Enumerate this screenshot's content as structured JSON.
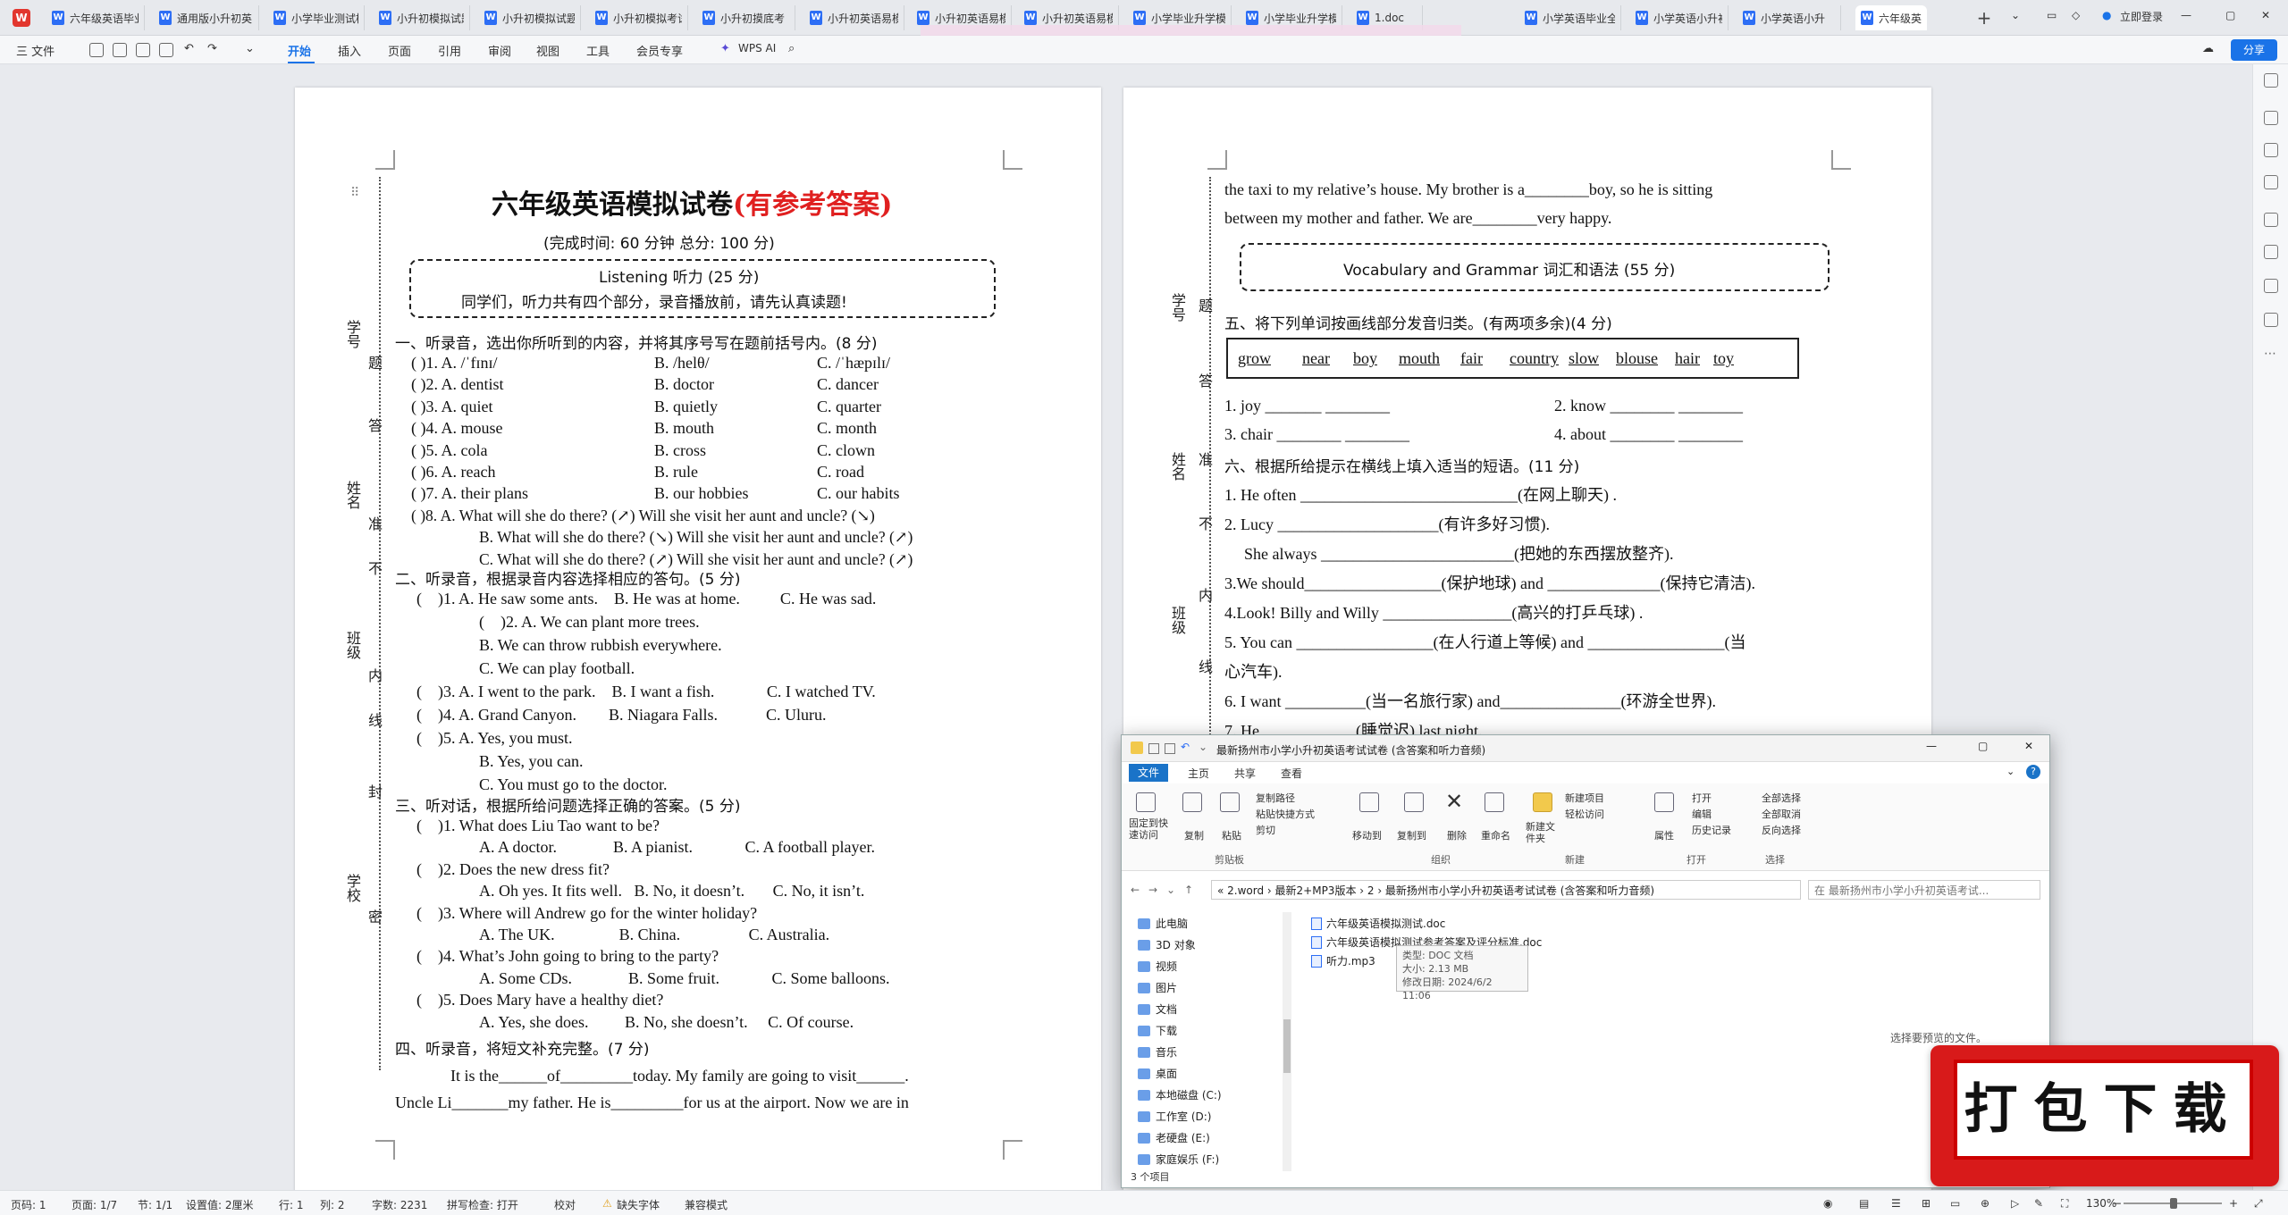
{
  "tabs": [
    {
      "label": "六年级英语毕业"
    },
    {
      "label": "通用版小升初英"
    },
    {
      "label": "小学毕业测试模"
    },
    {
      "label": "小升初模拟试题"
    },
    {
      "label": "小升初模拟试题"
    },
    {
      "label": "小升初模拟考试"
    },
    {
      "label": "小升初摸底考"
    },
    {
      "label": "小升初英语易模"
    },
    {
      "label": "小升初英语易模"
    },
    {
      "label": "小升初英语易模"
    },
    {
      "label": "小学毕业升学模"
    },
    {
      "label": "小学毕业升学模"
    },
    {
      "label": "1.doc"
    },
    {
      "label": "小学英语毕业全"
    },
    {
      "label": "小学英语小升初"
    },
    {
      "label": "小学英语小升"
    },
    {
      "label": "六年级英"
    }
  ],
  "tabbar_right": {
    "login": "立即登录"
  },
  "toolbar": {
    "file": "三 文件",
    "menus": [
      "开始",
      "插入",
      "页面",
      "引用",
      "审阅",
      "视图",
      "工具",
      "会员专享"
    ],
    "wps_ai": "WPS AI",
    "share": "分享"
  },
  "page1": {
    "title_main": "六年级英语模拟试卷",
    "title_red": "(有参考答案)",
    "subtitle": "(完成时间: 60 分钟  总分: 100 分)",
    "box_line1": "Listening 听力 (25 分)",
    "box_line2": "同学们，听力共有四个部分，录音播放前，请先认真读题!",
    "side_labels": [
      "学号",
      "题",
      "答",
      "姓名",
      "准",
      "不",
      "班级",
      "内",
      "线",
      "封",
      "学校",
      "密"
    ],
    "sec1": "一、听录音，选出你所听到的内容，并将其序号写在题前括号内。(8 分)",
    "q1": [
      [
        "(    )1. A. /ˈfɪnɪ/",
        "B. /helθ/",
        "C. /ˈhæpɪlɪ/"
      ],
      [
        "(    )2. A. dentist",
        "B. doctor",
        "C. dancer"
      ],
      [
        "(    )3. A. quiet",
        "B. quietly",
        "C. quarter"
      ],
      [
        "(    )4. A. mouse",
        "B. mouth",
        "C. month"
      ],
      [
        "(    )5. A. cola",
        "B. cross",
        "C. clown"
      ],
      [
        "(    )6. A. reach",
        "B. rule",
        "C. road"
      ],
      [
        "(    )7. A. their plans",
        "B. our hobbies",
        "C. our habits"
      ]
    ],
    "q1_8": [
      "(    )8. A. What will she do there? (↗) Will she visit her aunt and uncle? (↘)",
      "B. What will she do there? (↘) Will she visit her aunt and uncle? (↗)",
      "C. What will she do there? (↗) Will she visit her aunt and uncle? (↗)"
    ],
    "sec2": "二、听录音，根据录音内容选择相应的答句。(5 分)",
    "q2": [
      "(    )1. A. He saw some ants.    B. He was at home.          C. He was sad.",
      "(    )2. A. We can plant more trees.",
      "B. We can throw rubbish everywhere.",
      "C. We can play football.",
      "(    )3. A. I went to the park.    B. I want a fish.             C. I watched TV.",
      "(    )4. A. Grand Canyon.        B. Niagara Falls.            C. Uluru.",
      "(    )5. A. Yes, you must.",
      "B. Yes, you can.",
      "C. You must go to the doctor."
    ],
    "sec3": "三、听对话，根据所给问题选择正确的答案。(5 分)",
    "q3": [
      "(    )1. What does Liu Tao want to be?",
      "A. A doctor.              B. A pianist.             C. A football player.",
      "(    )2. Does the new dress fit?",
      "A. Oh yes. It fits well.   B. No, it doesn’t.       C. No, it isn’t.",
      "(    )3. Where will Andrew go for the winter holiday?",
      "A. The UK.                B. China.                 C. Australia.",
      "(    )4. What’s John going to bring to the party?",
      "A. Some CDs.              B. Some fruit.             C. Some balloons.",
      "(    )5. Does Mary have a healthy diet?",
      "A. Yes, she does.         B. No, she doesn’t.     C. Of course."
    ],
    "sec4": "四、听录音，将短文补充完整。(7 分)",
    "para1": "It is the______of_________today. My family are going to visit______.",
    "para2": "Uncle Li_______my father. He is_________for us at the airport. Now we are in"
  },
  "page2": {
    "para_top1": "the taxi to my relative’s house. My brother is a________boy, so he is sitting",
    "para_top2": "between my mother and father. We are________very happy.",
    "box": "Vocabulary and Grammar 词汇和语法 (55 分)",
    "side_labels": [
      "学号",
      "题",
      "答",
      "姓名",
      "准",
      "不",
      "班级",
      "内",
      "线"
    ],
    "sec5": "五、将下列单词按画线部分发音归类。(有两项多余)(4 分)",
    "words": [
      "grow",
      "near",
      "boy",
      "mouth",
      "fair",
      "country",
      "slow",
      "blouse",
      "hair",
      "toy"
    ],
    "q5": [
      "1.    joy _______    ________",
      "2. know ________    ________",
      "3. chair ________    ________",
      "4. about ________    ________"
    ],
    "sec6": "六、根据所给提示在横线上填入适当的短语。(11 分)",
    "q6": [
      "1. He often ___________________________(在网上聊天) .",
      "2. Lucy ____________________(有许多好习惯).",
      "She always ________________________(把她的东西摆放整齐).",
      "3.We should_________________(保护地球) and ______________(保持它清洁).",
      "4.Look! Billy and Willy ________________(高兴的打乒乓球) .",
      "5. You can _________________(在人行道上等候) and _________________(当",
      "心汽车).",
      "6. I want __________(当一名旅行家) and_______________(环游全世界).",
      "7. He____________(睡觉迟) last night."
    ]
  },
  "explorer": {
    "title": "最新扬州市小学小升初英语考试试卷 (含答案和听力音频)",
    "tabs": [
      "文件",
      "主页",
      "共享",
      "查看"
    ],
    "ribbon_items": [
      "固定到快速访问",
      "复制",
      "粘贴",
      "复制路径",
      "粘贴快捷方式",
      "剪切",
      "移动到",
      "复制到",
      "删除",
      "重命名",
      "新建文件夹",
      "新建项目",
      "轻松访问",
      "属性",
      "打开",
      "编辑",
      "历史记录",
      "全部选择",
      "全部取消",
      "反向选择"
    ],
    "ribbon_groups": [
      "剪贴板",
      "组织",
      "新建",
      "打开",
      "选择"
    ],
    "address": "« 2.word › 最新2+MP3版本 › 2 › 最新扬州市小学小升初英语考试试卷 (含答案和听力音频)",
    "search_placeholder": "在 最新扬州市小学小升初英语考试...",
    "tree": [
      "此电脑",
      "3D 对象",
      "视频",
      "图片",
      "文档",
      "下载",
      "音乐",
      "桌面",
      "本地磁盘 (C:)",
      "工作室 (D:)",
      "老硬盘 (E:)",
      "家庭娱乐 (F:)"
    ],
    "files": [
      "六年级英语模拟测试.doc",
      "六年级英语模拟测试参考答案及评分标准.doc",
      "听力.mp3"
    ],
    "tooltip": [
      "类型: DOC 文档",
      "大小: 2.13 MB",
      "修改日期: 2024/6/2 11:06"
    ],
    "preview_hint": "选择要预览的文件。",
    "status": "3 个项目"
  },
  "promo": {
    "label": "打包下载"
  },
  "statusbar": {
    "page": "页码: 1",
    "pages": "页面: 1/7",
    "section": "节: 1/1",
    "setting": "设置值: 2厘米",
    "row": "行: 1",
    "col": "列: 2",
    "words": "字数: 2231",
    "spell": "拼写检查: 打开",
    "proof": "校对",
    "font": "缺失字体",
    "compat": "兼容模式",
    "zoom": "130%"
  },
  "colors": {
    "accent": "#1a73e8",
    "title_red": "#e02020",
    "promo_red": "#d81a1a",
    "wps_red": "#e2362e"
  }
}
